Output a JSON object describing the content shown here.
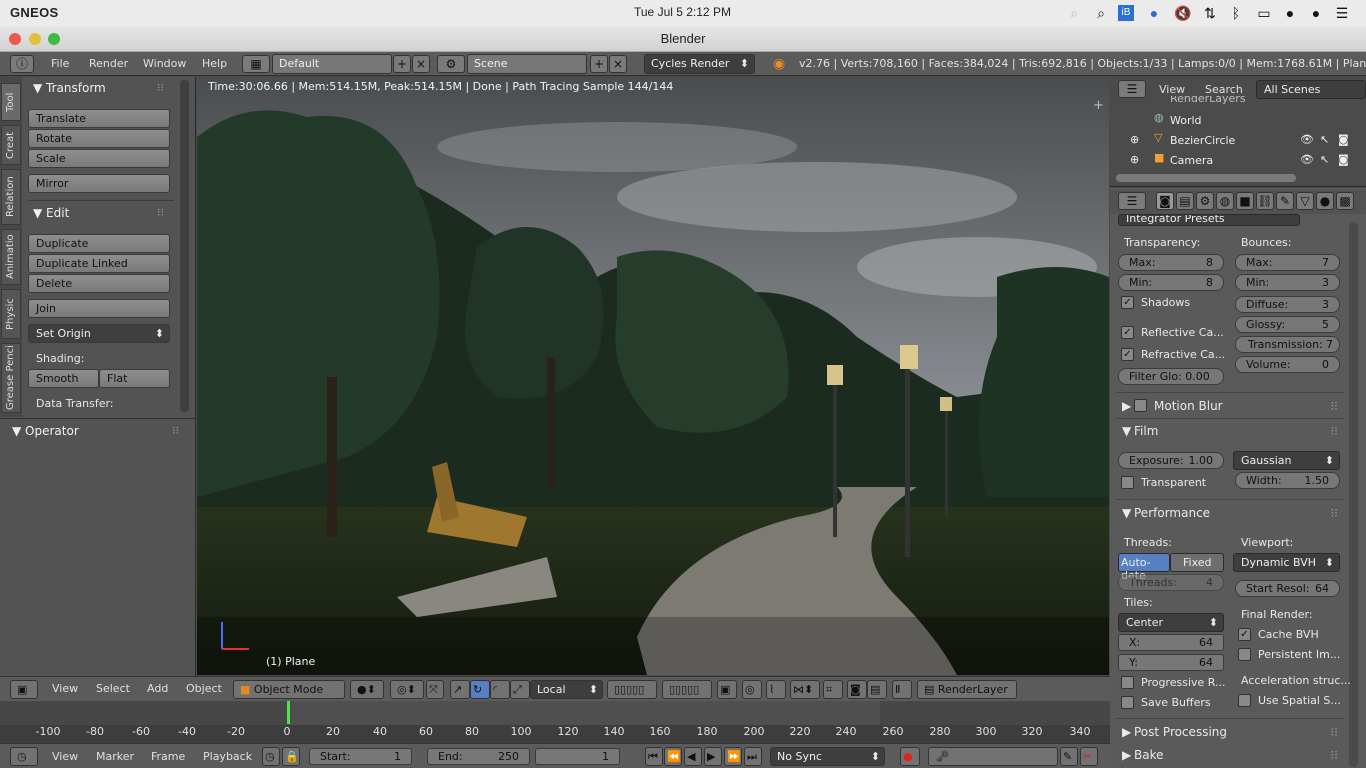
{
  "os": {
    "name": "GNEOS",
    "clock": "Tue Jul  5  2:12 PM"
  },
  "window": {
    "title": "Blender"
  },
  "info_header": {
    "menus": [
      "File",
      "Render",
      "Window",
      "Help"
    ],
    "layout": "Default",
    "scene": "Scene",
    "engine": "Cycles Render",
    "stats": "v2.76 | Verts:708,160 | Faces:384,024 | Tris:692,816 | Objects:1/33 | Lamps:0/0 | Mem:1768.61M | Plane"
  },
  "tool_tabs": [
    "Tool",
    "Creat",
    "Relation",
    "Animatio",
    "Physic",
    "Grease Penci"
  ],
  "tool_shelf": {
    "transform_title": "Transform",
    "transform": [
      "Translate",
      "Rotate",
      "Scale"
    ],
    "mirror": "Mirror",
    "edit_title": "Edit",
    "edit": [
      "Duplicate",
      "Duplicate Linked",
      "Delete"
    ],
    "join": "Join",
    "set_origin": "Set Origin",
    "shading_label": "Shading:",
    "smooth": "Smooth",
    "flat": "Flat",
    "data_transfer": "Data Transfer:",
    "operator": "Operator"
  },
  "viewport": {
    "render_info": "Time:30:06.66 | Mem:514.15M, Peak:514.15M | Done | Path Tracing Sample 144/144",
    "object_label": "(1) Plane"
  },
  "outliner": {
    "menus": [
      "View",
      "Search"
    ],
    "filter": "All Scenes",
    "items": [
      "RenderLayers",
      "World",
      "BezierCircle",
      "Camera"
    ]
  },
  "props": {
    "presets": "Integrator Presets",
    "transparency_label": "Transparency:",
    "bounces_label": "Bounces:",
    "t_max_label": "Max:",
    "t_max": "8",
    "t_min_label": "Min:",
    "t_min": "8",
    "b_max_label": "Max:",
    "b_max": "7",
    "b_min_label": "Min:",
    "b_min": "3",
    "shadows": "Shadows",
    "reflective": "Reflective Ca...",
    "refractive": "Refractive Ca...",
    "filter_glossy": "Filter Glo: 0.00",
    "diffuse_label": "Diffuse:",
    "diffuse": "3",
    "glossy_label": "Glossy:",
    "glossy": "5",
    "transmission_label": "Transmission:",
    "transmission": "7",
    "volume_label": "Volume:",
    "volume": "0",
    "motion_blur": "Motion Blur",
    "film": "Film",
    "exposure_label": "Exposure:",
    "exposure": "1.00",
    "filter": "Gaussian",
    "transparent": "Transparent",
    "width_label": "Width:",
    "width": "1.50",
    "performance": "Performance",
    "threads_label": "Threads:",
    "auto_detect": "Auto-dete",
    "fixed": "Fixed",
    "threads_field_label": "Threads:",
    "threads_value": "4",
    "viewport_label": "Viewport:",
    "bvh": "Dynamic BVH",
    "start_res_label": "Start Resol:",
    "start_res": "64",
    "tiles_label": "Tiles:",
    "tile_order": "Center",
    "x_label": "X:",
    "x": "64",
    "y_label": "Y:",
    "y": "64",
    "final_render": "Final Render:",
    "cache_bvh": "Cache BVH",
    "persistent": "Persistent Im...",
    "progressive": "Progressive R...",
    "save_buffers": "Save Buffers",
    "accel": "Acceleration struc...",
    "spatial": "Use Spatial S...",
    "post_processing": "Post Processing",
    "bake": "Bake"
  },
  "view3d_header": {
    "menus": [
      "View",
      "Select",
      "Add",
      "Object"
    ],
    "mode": "Object Mode",
    "orientation": "Local",
    "render_layer": "RenderLayer"
  },
  "timeline": {
    "ticks": [
      "-100",
      "-80",
      "-60",
      "-40",
      "-20",
      "0",
      "20",
      "40",
      "60",
      "80",
      "100",
      "120",
      "140",
      "160",
      "180",
      "200",
      "220",
      "240",
      "260",
      "280",
      "300",
      "320",
      "340"
    ],
    "current_frame_marker": "0"
  },
  "timeline_header": {
    "menus": [
      "View",
      "Marker",
      "Frame",
      "Playback"
    ],
    "start_label": "Start:",
    "start": "1",
    "end_label": "End:",
    "end": "250",
    "current": "1",
    "sync": "No Sync"
  }
}
